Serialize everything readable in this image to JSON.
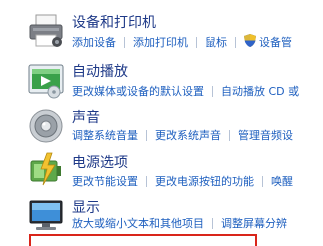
{
  "items": [
    {
      "title": "设备和打印机",
      "links": [
        "添加设备",
        "添加打印机",
        "鼠标",
        "设备管"
      ]
    },
    {
      "title": "自动播放",
      "links": [
        "更改媒体或设备的默认设置",
        "自动播放 CD 或"
      ]
    },
    {
      "title": "声音",
      "links": [
        "调整系统音量",
        "更改系统声音",
        "管理音频设"
      ]
    },
    {
      "title": "电源选项",
      "links": [
        "更改节能设置",
        "更改电源按钮的功能",
        "唤醒"
      ]
    },
    {
      "title": "显示",
      "links": [
        "放大或缩小文本和其他项目",
        "调整屏幕分辨"
      ]
    }
  ],
  "icons": [
    "printer-icon",
    "autoplay-icon",
    "speaker-icon",
    "power-options-icon",
    "display-monitor-icon"
  ],
  "colors": {
    "title": "#1f3a88",
    "link": "#1e5fbf",
    "highlight_box": "#d9251a"
  }
}
